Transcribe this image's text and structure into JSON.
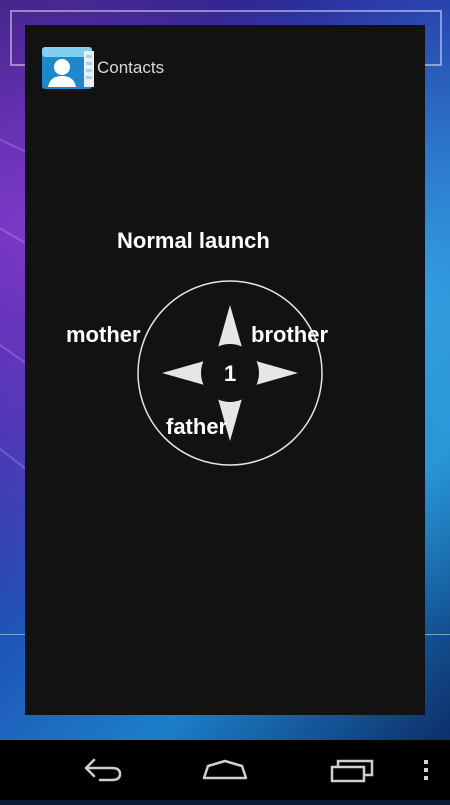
{
  "app": {
    "title": "Contacts",
    "icon": "contacts-app-icon"
  },
  "menu": {
    "header": "Normal launch",
    "center_count": "1",
    "options": {
      "left": "mother",
      "right": "brother",
      "bottom": "father"
    }
  },
  "navbar": {
    "back": "back-icon",
    "home": "home-icon",
    "recents": "recent-apps-icon",
    "overflow": "overflow-menu-icon"
  },
  "colors": {
    "dialog_bg": "#121212",
    "text": "#ffffff",
    "star": "#e6e6e6"
  }
}
